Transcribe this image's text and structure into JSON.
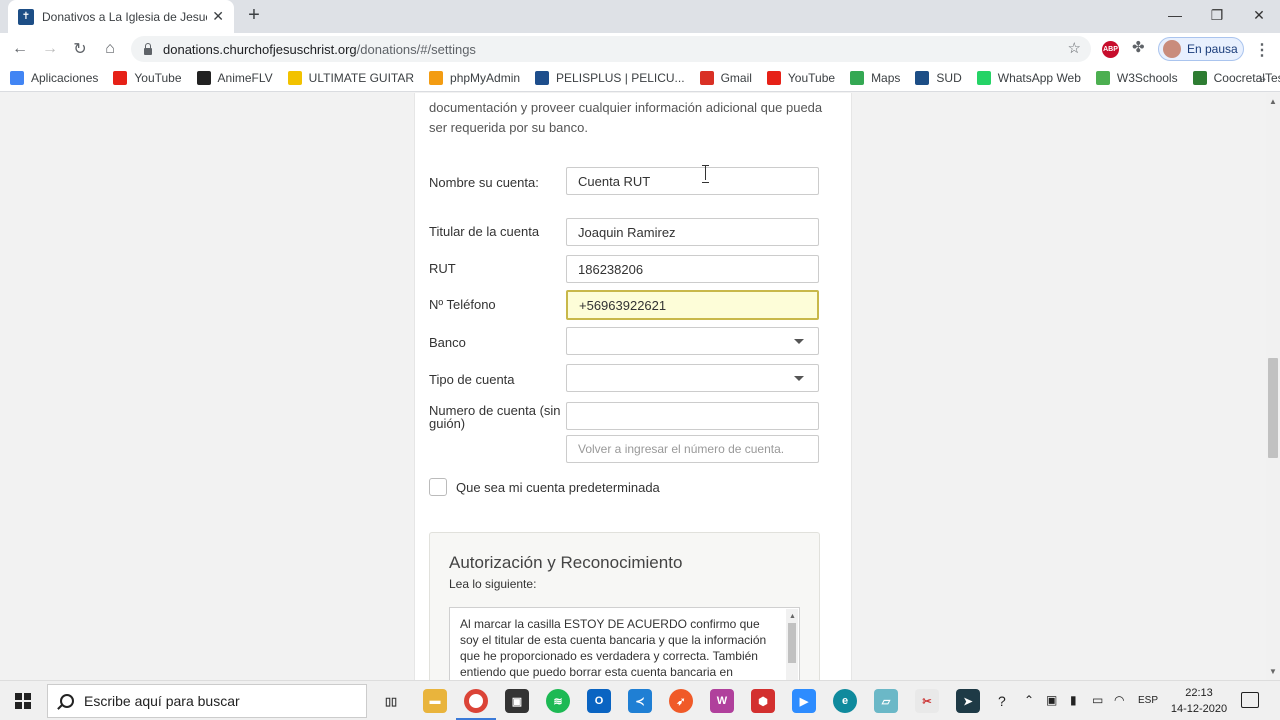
{
  "browser": {
    "tab_title": "Donativos a La Iglesia de Jesucristo",
    "url_host": "donations.churchofjesuschrist.org",
    "url_path": "/donations/#/settings",
    "profile_label": "En pausa",
    "bookmarks": [
      {
        "label": "Aplicaciones",
        "color": "#4285f4"
      },
      {
        "label": "YouTube",
        "color": "#e62117"
      },
      {
        "label": "AnimeFLV",
        "color": "#222222"
      },
      {
        "label": "ULTIMATE GUITAR",
        "color": "#f2c200"
      },
      {
        "label": "phpMyAdmin",
        "color": "#f39c12"
      },
      {
        "label": "PELISPLUS | PELICU...",
        "color": "#1e4e8c"
      },
      {
        "label": "Gmail",
        "color": "#d93025"
      },
      {
        "label": "YouTube",
        "color": "#e62117"
      },
      {
        "label": "Maps",
        "color": "#34a853"
      },
      {
        "label": "SUD",
        "color": "#1d4e86"
      },
      {
        "label": "WhatsApp Web",
        "color": "#25d366"
      },
      {
        "label": "W3Schools",
        "color": "#4caf50"
      },
      {
        "label": "CoocretalTest",
        "color": "#2e7d32"
      }
    ]
  },
  "page": {
    "intro_text": "documentación y proveer cualquier información adicional que pueda ser requerida por su banco.",
    "account_name_label": "Nombre su cuenta:",
    "account_name_value": "Cuenta RUT",
    "holder_label": "Titular de la cuenta",
    "holder_value": "Joaquin Ramirez",
    "rut_label": "RUT",
    "rut_value": "186238206",
    "phone_label": "Nº Teléfono",
    "phone_value": "+56963922621",
    "bank_label": "Banco",
    "bank_value": "",
    "account_type_label": "Tipo de cuenta",
    "account_type_value": "",
    "account_number_label": "Numero de cuenta (sin guión)",
    "account_number_value": "",
    "account_number_confirm_placeholder": "Volver a ingresar el número de cuenta.",
    "default_checkbox_label": "Que sea mi cuenta predeterminada",
    "auth_title": "Autorización y Reconocimiento",
    "auth_subtitle": "Lea lo siguiente:",
    "auth_text": "Al marcar la casilla ESTOY DE ACUERDO confirmo que soy el titular de esta cuenta bancaria y que la información que he proporcionado es verdadera y correcta. También entiendo que puedo borrar esta cuenta bancaria en"
  },
  "taskbar": {
    "search_placeholder": "Escribe aquí para buscar",
    "language": "ESP",
    "time": "22:13",
    "date": "14-12-2020"
  }
}
